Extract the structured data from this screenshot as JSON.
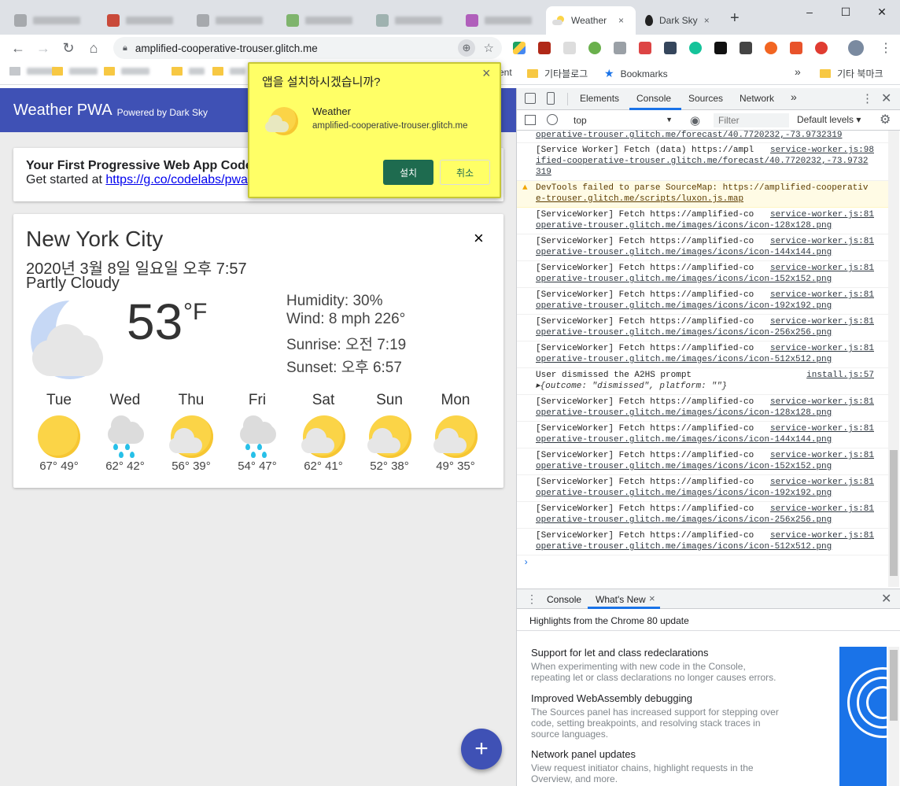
{
  "browser": {
    "active_tab": {
      "title": "Weather",
      "close": "×"
    },
    "tab_darksky": {
      "title": "Dark Sky",
      "close": "×"
    },
    "new_tab": "+",
    "url": "amplified-cooperative-trouser.glitch.me",
    "window": {
      "minimize": "–",
      "maximize": "☐",
      "close": "✕"
    },
    "bookmarks": {
      "partial": "ent",
      "etc_blog": "기타블로그",
      "bookmarks_label": "Bookmarks",
      "more": "»",
      "other": "기타 북마크"
    }
  },
  "app": {
    "title": "Weather PWA",
    "powered": "Powered by Dark Sky",
    "intro_title": "Your First Progressive Web App Code",
    "intro_get": "Get started at ",
    "intro_link": "https://g.co/codelabs/pwa",
    "weather": {
      "city": "New York City",
      "date": "2020년 3월 8일 일요일 오후 7:57",
      "desc": "Partly Cloudy",
      "temp": "53",
      "unit": "°F",
      "humidity": "Humidity: 30%",
      "wind": "Wind: 8 mph 226°",
      "sunrise": "Sunrise: 오전 7:19",
      "sunset": "Sunset: 오후 6:57",
      "close": "×",
      "forecast": [
        {
          "day": "Tue",
          "temps": "67° 49°",
          "icon": "clear-day-icon"
        },
        {
          "day": "Wed",
          "temps": "62° 42°",
          "icon": "rain-icon"
        },
        {
          "day": "Thu",
          "temps": "56° 39°",
          "icon": "partly-cloudy-icon"
        },
        {
          "day": "Fri",
          "temps": "54° 47°",
          "icon": "rain-icon"
        },
        {
          "day": "Sat",
          "temps": "62° 41°",
          "icon": "partly-cloudy-icon"
        },
        {
          "day": "Sun",
          "temps": "52° 38°",
          "icon": "partly-cloudy-icon"
        },
        {
          "day": "Mon",
          "temps": "49° 35°",
          "icon": "partly-cloudy-icon"
        }
      ]
    },
    "fab": "+"
  },
  "dialog": {
    "title": "앱을 설치하시겠습니까?",
    "app_name": "Weather",
    "app_url": "amplified-cooperative-trouser.glitch.me",
    "install": "설치",
    "cancel": "취소",
    "close": "×"
  },
  "devtools": {
    "tabs": [
      "Elements",
      "Console",
      "Sources",
      "Network"
    ],
    "more_tabs": "»",
    "context": "top",
    "filter_placeholder": "Filter",
    "levels": "Default levels ▾",
    "logs": [
      {
        "l1": "operative-trouser.glitch.me/forecast/40.7720232,-73.9732319",
        "l2": "",
        "src": "",
        "type": "cont"
      },
      {
        "l1": "[Service Worker] Fetch (data) https://ampl",
        "l2": "ified-cooperative-trouser.glitch.me/forecast/40.7720232,-73.9732",
        "l3": "319",
        "src": "service-worker.js:98",
        "type": "log3"
      },
      {
        "l1": "DevTools failed to parse SourceMap: https://amplified-cooperativ",
        "l2": "e-trouser.glitch.me/scripts/luxon.js.map",
        "src": "",
        "type": "warn"
      },
      {
        "l1": "[ServiceWorker] Fetch https://amplified-co",
        "l2": "operative-trouser.glitch.me/images/icons/icon-128x128.png",
        "src": "service-worker.js:81",
        "type": "log"
      },
      {
        "l1": "[ServiceWorker] Fetch https://amplified-co",
        "l2": "operative-trouser.glitch.me/images/icons/icon-144x144.png",
        "src": "service-worker.js:81",
        "type": "log"
      },
      {
        "l1": "[ServiceWorker] Fetch https://amplified-co",
        "l2": "operative-trouser.glitch.me/images/icons/icon-152x152.png",
        "src": "service-worker.js:81",
        "type": "log"
      },
      {
        "l1": "[ServiceWorker] Fetch https://amplified-co",
        "l2": "operative-trouser.glitch.me/images/icons/icon-192x192.png",
        "src": "service-worker.js:81",
        "type": "log"
      },
      {
        "l1": "[ServiceWorker] Fetch https://amplified-co",
        "l2": "operative-trouser.glitch.me/images/icons/icon-256x256.png",
        "src": "service-worker.js:81",
        "type": "log"
      },
      {
        "l1": "[ServiceWorker] Fetch https://amplified-co",
        "l2": "operative-trouser.glitch.me/images/icons/icon-512x512.png",
        "src": "service-worker.js:81",
        "type": "log"
      },
      {
        "l1": "User dismissed the A2HS prompt",
        "l2": "▸{outcome: \"dismissed\", platform: \"\"}",
        "src": "install.js:57",
        "type": "obj"
      },
      {
        "l1": "[ServiceWorker] Fetch https://amplified-co",
        "l2": "operative-trouser.glitch.me/images/icons/icon-128x128.png",
        "src": "service-worker.js:81",
        "type": "log"
      },
      {
        "l1": "[ServiceWorker] Fetch https://amplified-co",
        "l2": "operative-trouser.glitch.me/images/icons/icon-144x144.png",
        "src": "service-worker.js:81",
        "type": "log"
      },
      {
        "l1": "[ServiceWorker] Fetch https://amplified-co",
        "l2": "operative-trouser.glitch.me/images/icons/icon-152x152.png",
        "src": "service-worker.js:81",
        "type": "log"
      },
      {
        "l1": "[ServiceWorker] Fetch https://amplified-co",
        "l2": "operative-trouser.glitch.me/images/icons/icon-192x192.png",
        "src": "service-worker.js:81",
        "type": "log"
      },
      {
        "l1": "[ServiceWorker] Fetch https://amplified-co",
        "l2": "operative-trouser.glitch.me/images/icons/icon-256x256.png",
        "src": "service-worker.js:81",
        "type": "log"
      },
      {
        "l1": "[ServiceWorker] Fetch https://amplified-co",
        "l2": "operative-trouser.glitch.me/images/icons/icon-512x512.png",
        "src": "service-worker.js:81",
        "type": "log"
      }
    ],
    "prompt": "›",
    "drawer_tabs": [
      "Console",
      "What's New"
    ],
    "drawer_close": "×",
    "highlights": "Highlights from the Chrome 80 update",
    "whats_new": [
      {
        "h": "Support for let and class redeclarations",
        "d1": "When experimenting with new code in the Console,",
        "d2": "repeating let or class declarations no longer causes errors.",
        "d3": ""
      },
      {
        "h": "Improved WebAssembly debugging",
        "d1": "The Sources panel has increased support for stepping over",
        "d2": "code, setting breakpoints, and resolving stack traces in",
        "d3": "source languages."
      },
      {
        "h": "Network panel updates",
        "d1": "View request initiator chains, highlight requests in the",
        "d2": "Overview, and more.",
        "d3": ""
      }
    ]
  },
  "colors": {
    "header": "#3f51b5",
    "fab": "#3f51b5",
    "dialog_bg": "#ffff66",
    "install_btn": "#1e6b4f",
    "sun": "#fbd447"
  }
}
